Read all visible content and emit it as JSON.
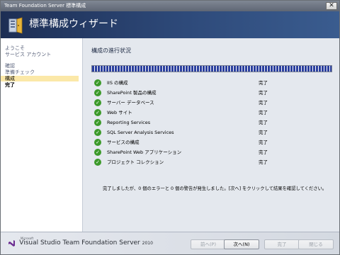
{
  "window": {
    "title": "Team Foundation Server 標準構成",
    "close_glyph": "✕"
  },
  "banner": {
    "title": "標準構成ウィザード"
  },
  "nav": {
    "items": [
      {
        "label": "ようこそ",
        "state": "normal"
      },
      {
        "label": "サービス アカウント",
        "state": "normal"
      },
      {
        "label": "確認",
        "state": "normal"
      },
      {
        "label": "準備チェック",
        "state": "normal"
      },
      {
        "label": "構成",
        "state": "active"
      },
      {
        "label": "完了",
        "state": "done"
      }
    ]
  },
  "main": {
    "section_title": "構成の進行状況",
    "progress_fraction": 1.0,
    "steps": [
      {
        "name": "IIS の構成",
        "status": "完了"
      },
      {
        "name": "SharePoint 製品の構成",
        "status": "完了"
      },
      {
        "name": "サーバー データベース",
        "status": "完了"
      },
      {
        "name": "Web サイト",
        "status": "完了"
      },
      {
        "name": "Reporting Services",
        "status": "完了"
      },
      {
        "name": "SQL Server Analysis Services",
        "status": "完了"
      },
      {
        "name": "サービスの構成",
        "status": "完了"
      },
      {
        "name": "SharePoint Web アプリケーション",
        "status": "完了"
      },
      {
        "name": "プロジェクト コレクション",
        "status": "完了"
      }
    ],
    "summary": "完了しましたが、0 個のエラーと 0 個の警告が発生しました。[次へ] をクリックして結果を確認してください。"
  },
  "footer": {
    "brand_microsoft": "Microsoft",
    "brand_name": "Visual Studio Team Foundation Server",
    "brand_year": "2010",
    "buttons": {
      "back": "前へ(P)",
      "next": "次へ(N)",
      "finish": "完了",
      "close": "閉じる"
    }
  },
  "colors": {
    "banner": "#1d2e54",
    "progress": "#2a3f9e",
    "check": "#3c9a2a",
    "active_nav": "#fbe8a8"
  }
}
